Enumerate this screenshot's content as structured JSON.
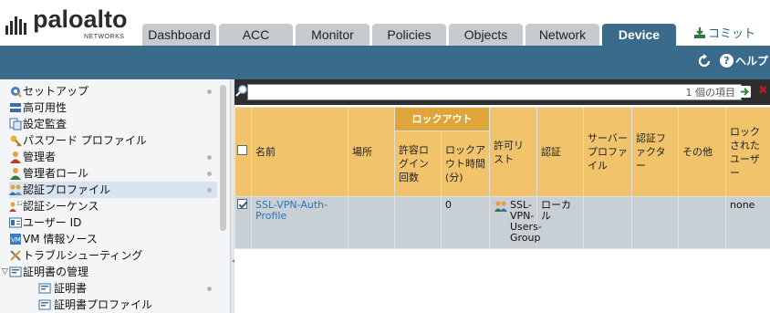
{
  "brand": {
    "name": "paloalto",
    "sub": "NETWORKS"
  },
  "tabs": [
    {
      "label": "Dashboard",
      "active": false
    },
    {
      "label": "ACC",
      "active": false
    },
    {
      "label": "Monitor",
      "active": false
    },
    {
      "label": "Policies",
      "active": false
    },
    {
      "label": "Objects",
      "active": false
    },
    {
      "label": "Network",
      "active": false
    },
    {
      "label": "Device",
      "active": true
    }
  ],
  "commit_label": "コミット",
  "help_label": "ヘルプ",
  "nav": [
    {
      "label": "セットアップ",
      "icon": "setup-icon",
      "dot": true
    },
    {
      "label": "高可用性",
      "icon": "ha-icon",
      "dot": false
    },
    {
      "label": "設定監査",
      "icon": "audit-icon",
      "dot": false
    },
    {
      "label": "パスワード プロファイル",
      "icon": "password-icon",
      "dot": false
    },
    {
      "label": "管理者",
      "icon": "admin-icon",
      "dot": true
    },
    {
      "label": "管理者ロール",
      "icon": "admin-role-icon",
      "dot": true
    },
    {
      "label": "認証プロファイル",
      "icon": "auth-profile-icon",
      "dot": true,
      "selected": true
    },
    {
      "label": "認証シーケンス",
      "icon": "auth-sequence-icon",
      "dot": false
    },
    {
      "label": "ユーザー ID",
      "icon": "user-id-icon",
      "dot": false
    },
    {
      "label": "VM 情報ソース",
      "icon": "vm-icon",
      "dot": false
    },
    {
      "label": "トラブルシューティング",
      "icon": "troubleshoot-icon",
      "dot": false
    },
    {
      "label": "証明書の管理",
      "icon": "cert-mgmt-icon",
      "dot": false,
      "expanded": true
    },
    {
      "label": "証明書",
      "icon": "cert-icon",
      "dot": true,
      "child": true
    },
    {
      "label": "証明書プロファイル",
      "icon": "cert-profile-icon",
      "dot": false,
      "child": true
    }
  ],
  "search": {
    "count_text": "1 個の項目"
  },
  "table": {
    "group_header": "ロックアウト",
    "columns": {
      "name": "名前",
      "location": "場所",
      "allowed_attempts": "許容ログイン回数",
      "lockout_time": "ロックアウト時間(分)",
      "allow_list": "許可リスト",
      "auth": "認証",
      "server_profile": "サーバー プロファイル",
      "auth_factor": "認証ファクター",
      "other": "その他",
      "locked_users": "ロックされたユーザー"
    },
    "rows": [
      {
        "checked": true,
        "name": "SSL-VPN-Auth-Profile",
        "location": "",
        "allowed_attempts": "",
        "lockout_time": "0",
        "allow_list": "SSL-VPN-Users-Group",
        "auth": "ローカル",
        "server_profile": "",
        "auth_factor": "",
        "other": "",
        "locked_users": "none"
      }
    ]
  },
  "colors": {
    "accent": "#3a6b8a",
    "header_orange": "#f1c46c",
    "group_orange": "#e0a53a",
    "row_selected": "#c9d0d5",
    "link": "#2e73b8"
  }
}
